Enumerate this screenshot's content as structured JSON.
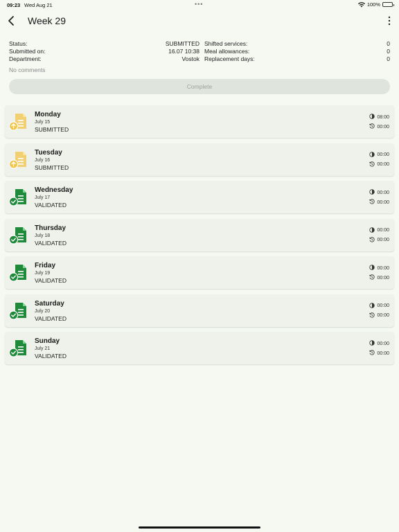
{
  "status_bar": {
    "time": "09:23",
    "date": "Wed Aug 21",
    "battery": "100%"
  },
  "header": {
    "title": "Week 29"
  },
  "summary": {
    "status_label": "Status:",
    "status_value": "SUBMITTED",
    "submitted_label": "Submitted on:",
    "submitted_value": "16.07 10:38",
    "department_label": "Department:",
    "department_value": "Vostok",
    "shifted_label": "Shifted services:",
    "shifted_value": "0",
    "meal_label": "Meal allowances:",
    "meal_value": "0",
    "replacement_label": "Replacement days:",
    "replacement_value": "0"
  },
  "comments": "No comments",
  "complete_button": "Complete",
  "colors": {
    "submitted": "#f0c44a",
    "validated": "#1f8b3a"
  },
  "days": [
    {
      "name": "Monday",
      "date": "July 15",
      "status": "SUBMITTED",
      "worked": "08:00",
      "overtime": "00:00"
    },
    {
      "name": "Tuesday",
      "date": "July 16",
      "status": "SUBMITTED",
      "worked": "00:00",
      "overtime": "00:00"
    },
    {
      "name": "Wednesday",
      "date": "July 17",
      "status": "VALIDATED",
      "worked": "00:00",
      "overtime": "00:00"
    },
    {
      "name": "Thursday",
      "date": "July 18",
      "status": "VALIDATED",
      "worked": "00:00",
      "overtime": "00:00"
    },
    {
      "name": "Friday",
      "date": "July 19",
      "status": "VALIDATED",
      "worked": "00:00",
      "overtime": "00:00"
    },
    {
      "name": "Saturday",
      "date": "July 20",
      "status": "VALIDATED",
      "worked": "00:00",
      "overtime": "00:00"
    },
    {
      "name": "Sunday",
      "date": "July 21",
      "status": "VALIDATED",
      "worked": "00:00",
      "overtime": "00:00"
    }
  ]
}
